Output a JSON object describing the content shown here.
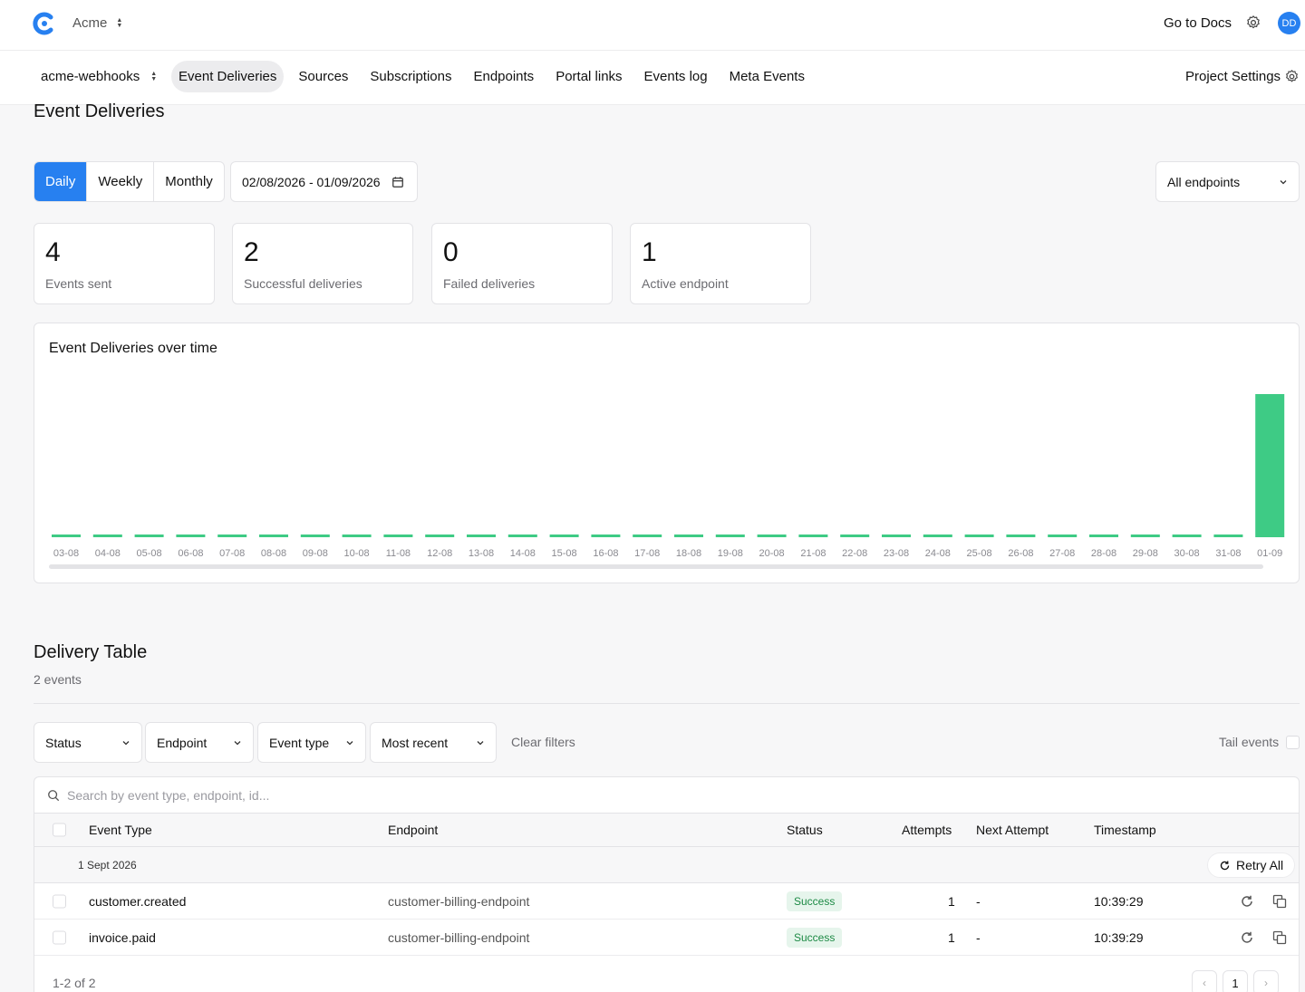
{
  "topbar": {
    "org_name": "Acme",
    "go_to_docs": "Go to Docs",
    "avatar_initials": "DD"
  },
  "nav": {
    "project_name": "acme-webhooks",
    "tabs": [
      {
        "label": "Event Deliveries",
        "active": true
      },
      {
        "label": "Sources"
      },
      {
        "label": "Subscriptions"
      },
      {
        "label": "Endpoints"
      },
      {
        "label": "Portal links"
      },
      {
        "label": "Events log"
      },
      {
        "label": "Meta Events"
      }
    ],
    "project_settings": "Project Settings"
  },
  "page_title": "Event Deliveries",
  "controls": {
    "periods": [
      "Daily",
      "Weekly",
      "Monthly"
    ],
    "active_period": "Daily",
    "date_range": "02/08/2026 - 01/09/2026",
    "endpoint_filter": "All endpoints"
  },
  "stats": [
    {
      "value": "4",
      "label": "Events sent"
    },
    {
      "value": "2",
      "label": "Successful deliveries"
    },
    {
      "value": "0",
      "label": "Failed deliveries"
    },
    {
      "value": "1",
      "label": "Active endpoint"
    }
  ],
  "chart_data": {
    "type": "bar",
    "title": "Event Deliveries over time",
    "categories": [
      "03-08",
      "04-08",
      "05-08",
      "06-08",
      "07-08",
      "08-08",
      "09-08",
      "10-08",
      "11-08",
      "12-08",
      "13-08",
      "14-08",
      "15-08",
      "16-08",
      "17-08",
      "18-08",
      "19-08",
      "20-08",
      "21-08",
      "22-08",
      "23-08",
      "24-08",
      "25-08",
      "26-08",
      "27-08",
      "28-08",
      "29-08",
      "30-08",
      "31-08",
      "01-09"
    ],
    "values": [
      0,
      0,
      0,
      0,
      0,
      0,
      0,
      0,
      0,
      0,
      0,
      0,
      0,
      0,
      0,
      0,
      0,
      0,
      0,
      0,
      0,
      0,
      0,
      0,
      0,
      0,
      0,
      0,
      0,
      2
    ],
    "bar_color": "#3ecb85",
    "grid": false
  },
  "delivery_table": {
    "title": "Delivery Table",
    "count_label": "2 events",
    "filters": [
      "Status",
      "Endpoint",
      "Event type",
      "Most recent"
    ],
    "clear_filters": "Clear filters",
    "tail_events": "Tail events",
    "search_placeholder": "Search by event type, endpoint, id...",
    "columns": [
      "Event Type",
      "Endpoint",
      "Status",
      "Attempts",
      "Next Attempt",
      "Timestamp"
    ],
    "group_date": "1 Sept 2026",
    "retry_all": "Retry All",
    "rows": [
      {
        "event_type": "customer.created",
        "endpoint": "customer-billing-endpoint",
        "status": "Success",
        "attempts": "1",
        "next_attempt": "-",
        "timestamp": "10:39:29"
      },
      {
        "event_type": "invoice.paid",
        "endpoint": "customer-billing-endpoint",
        "status": "Success",
        "attempts": "1",
        "next_attempt": "-",
        "timestamp": "10:39:29"
      }
    ],
    "pagination": {
      "info": "1-2 of 2",
      "current_page": "1",
      "prev": "‹",
      "next": "›"
    }
  },
  "colors": {
    "accent": "#2780f0",
    "success_bg": "#e6f5ec",
    "success_text": "#1d8a45",
    "bar": "#3ecb85"
  }
}
